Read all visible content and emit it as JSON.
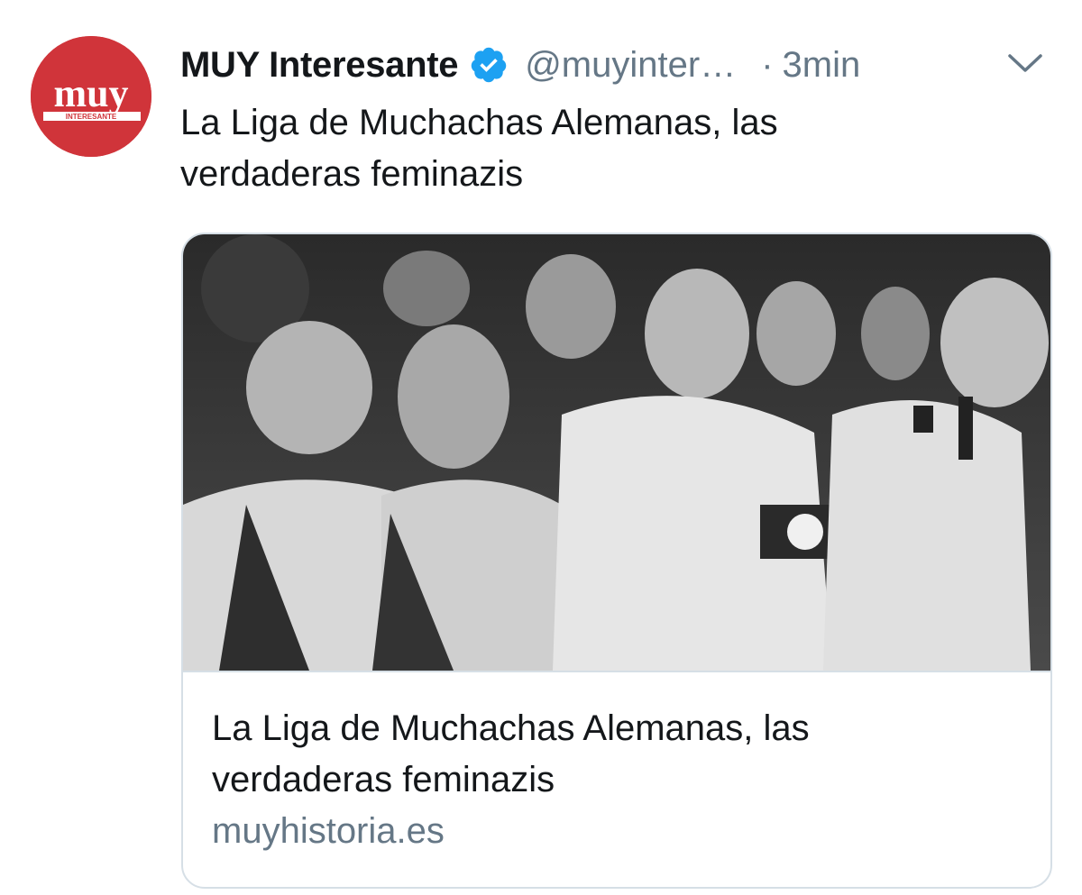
{
  "tweet": {
    "author_name": "MUY Interesante",
    "handle": "@muyinter…",
    "separator": "·",
    "timestamp": "3min",
    "text_line1": "La Liga de Muchachas Alemanas, las",
    "text_line2": "verdaderas feminazis"
  },
  "avatar": {
    "logo_main": "muy",
    "logo_sub": "INTERESANTE",
    "background_color": "#d0343a"
  },
  "card": {
    "title_line1": "La Liga de Muchachas Alemanas, las",
    "title_line2": "verdaderas feminazis",
    "domain": "muyhistoria.es",
    "image_kind": "black-and-white-historical-photo"
  },
  "icons": {
    "verified": "verified-badge-icon",
    "menu": "chevron-down-icon"
  },
  "colors": {
    "verified_blue": "#1da1f2",
    "secondary_text": "#657786",
    "primary_text": "#14171a",
    "border": "#d6dfe6"
  }
}
